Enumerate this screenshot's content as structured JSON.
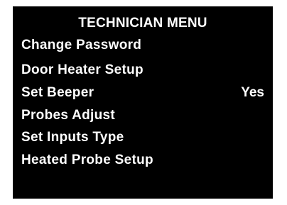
{
  "screen": {
    "title": "TECHNICIAN MENU",
    "items": [
      {
        "label": "Change Password",
        "value": ""
      },
      {
        "label": "Door Heater Setup",
        "value": ""
      },
      {
        "label": "Set Beeper",
        "value": "Yes"
      },
      {
        "label": "Probes Adjust",
        "value": ""
      },
      {
        "label": "Set Inputs Type",
        "value": ""
      },
      {
        "label": "Heated Probe Setup",
        "value": ""
      }
    ]
  }
}
